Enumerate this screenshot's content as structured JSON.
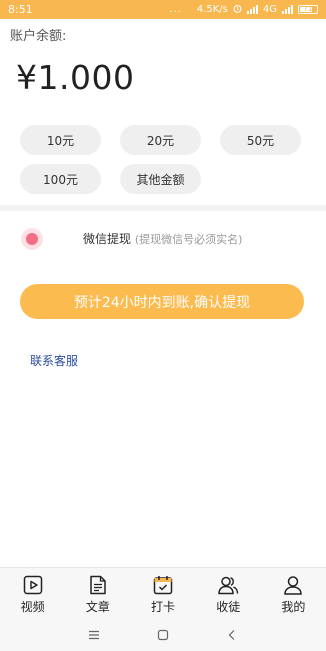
{
  "status_bar": {
    "time": "8:51",
    "dots": "...",
    "speed": "4.5K/s",
    "network": "4G",
    "battery": "71"
  },
  "balance": {
    "label": "账户余额:",
    "amount": "¥1.000"
  },
  "amount_options": [
    "10元",
    "20元",
    "50元",
    "100元",
    "其他金额"
  ],
  "withdraw_method": {
    "label": "微信提现",
    "hint": "(提现微信号必须实名)"
  },
  "confirm_button": "预计24小时内到账,确认提现",
  "contact_link": "联系客服",
  "bottom_nav": [
    {
      "icon": "video-icon",
      "label": "视频"
    },
    {
      "icon": "article-icon",
      "label": "文章"
    },
    {
      "icon": "checkin-icon",
      "label": "打卡"
    },
    {
      "icon": "apprentice-icon",
      "label": "收徒"
    },
    {
      "icon": "profile-icon",
      "label": "我的"
    }
  ],
  "colors": {
    "status_bar": "#f8b74f",
    "confirm_button": "#fcbb4f",
    "radio": "#f26d83",
    "link": "#2c4aa0"
  }
}
